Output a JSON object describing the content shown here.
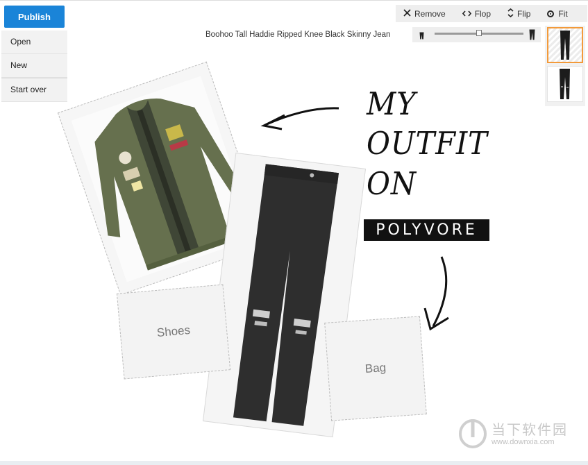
{
  "sidebar": {
    "publish_label": "Publish",
    "menu": [
      {
        "label": "Open"
      },
      {
        "label": "New"
      },
      {
        "label": "Start over"
      }
    ]
  },
  "toolbar": {
    "remove_label": "Remove",
    "flop_label": "Flop",
    "flip_label": "Flip",
    "fit_label": "Fit",
    "remove_icon": "close-icon",
    "flop_icon": "flop-icon",
    "flip_icon": "flip-icon",
    "fit_icon": "target-icon"
  },
  "selected_item": {
    "name": "Boohoo Tall Haddie Ripped Knee Black Skinny Jean",
    "size_fraction": 0.5
  },
  "canvas": {
    "title_lines": [
      "MY",
      "OUTFIT",
      "ON"
    ],
    "brand": "POLYVORE",
    "placeholders": {
      "shoes": "Shoes",
      "bag": "Bag"
    }
  },
  "watermark": {
    "cn": "当下软件园",
    "url": "www.downxia.com"
  },
  "colors": {
    "accent": "#1a84d8",
    "selection": "#f39a3a",
    "jacket": "#66704e",
    "jeans": "#2e2e2e"
  }
}
